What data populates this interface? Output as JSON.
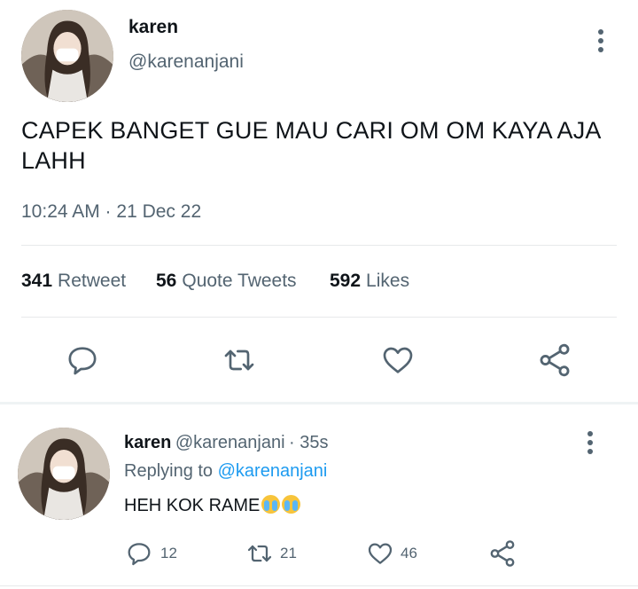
{
  "tweet": {
    "name": "karen",
    "handle": "@karenanjani",
    "text": "CAPEK BANGET GUE MAU CARI OM OM KAYA AJA LAHH",
    "timestamp": "10:24 AM · 21 Dec 22",
    "stats": {
      "retweets": "341",
      "retweets_label": "Retweet",
      "quotes": "56",
      "quotes_label": "Quote Tweets",
      "likes": "592",
      "likes_label": "Likes"
    },
    "actions": [
      "reply-icon",
      "retweet-icon",
      "like-icon",
      "share-icon"
    ]
  },
  "reply": {
    "name": "karen",
    "handle": "@karenanjani",
    "time": "· 35s",
    "replying_prefix": "Replying to",
    "replying_to": "@karenanjani",
    "text": "HEH KOK RAME",
    "emoji": "loudly-crying-face-emoji",
    "counts": {
      "replies": "12",
      "retweets": "21",
      "likes": "46"
    }
  },
  "colors": {
    "text": "#0f1419",
    "muted": "#536471",
    "link": "#1d9bf0",
    "divider": "#e7e9ea"
  }
}
